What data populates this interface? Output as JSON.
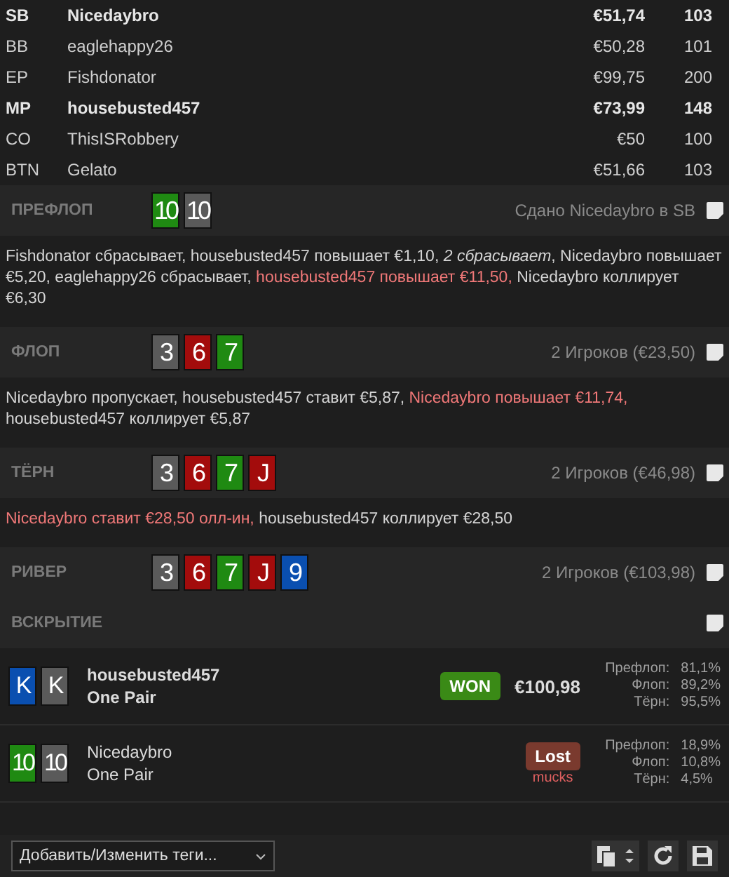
{
  "players": [
    {
      "position": "SB",
      "name": "Nicedaybro",
      "stack": "€51,74",
      "bb": "103",
      "highlighted": true
    },
    {
      "position": "BB",
      "name": "eaglehappy26",
      "stack": "€50,28",
      "bb": "101",
      "highlighted": false
    },
    {
      "position": "EP",
      "name": "Fishdonator",
      "stack": "€99,75",
      "bb": "200",
      "highlighted": false
    },
    {
      "position": "MP",
      "name": "housebusted457",
      "stack": "€73,99",
      "bb": "148",
      "highlighted": true
    },
    {
      "position": "CO",
      "name": "ThisISRobbery",
      "stack": "€50",
      "bb": "100",
      "highlighted": false
    },
    {
      "position": "BTN",
      "name": "Gelato",
      "stack": "€51,66",
      "bb": "103",
      "highlighted": false
    }
  ],
  "streets": [
    {
      "title": "ПРЕФЛОП",
      "cards": [
        {
          "rank": "10",
          "color": "#1f8a12"
        },
        {
          "rank": "10",
          "color": "#5a5a5a"
        }
      ],
      "info": "Сдано Nicedaybro в SB",
      "actions": [
        {
          "kind": "plain",
          "text": "Fishdonator сбрасывает, housebusted457 повышает €1,10, "
        },
        {
          "kind": "italic",
          "text": "2 сбрасывает"
        },
        {
          "kind": "plain",
          "text": ", Nicedaybro повышает €5,20, eaglehappy26 сбрасывает, "
        },
        {
          "kind": "aggressive",
          "text": "housebusted457 повышает €11,50,"
        },
        {
          "kind": "plain",
          "text": " Nicedaybro коллирует €6,30"
        }
      ]
    },
    {
      "title": "ФЛОП",
      "cards": [
        {
          "rank": "3",
          "color": "#5a5a5a"
        },
        {
          "rank": "6",
          "color": "#a30c0c"
        },
        {
          "rank": "7",
          "color": "#1f8a12"
        }
      ],
      "info": "2 Игроков (€23,50)",
      "actions": [
        {
          "kind": "plain",
          "text": "Nicedaybro пропускает, housebusted457 ставит €5,87, "
        },
        {
          "kind": "aggressive",
          "text": "Nicedaybro повышает €11,74,"
        },
        {
          "kind": "plain",
          "text": " housebusted457 коллирует €5,87"
        }
      ]
    },
    {
      "title": "ТЁРН",
      "cards": [
        {
          "rank": "3",
          "color": "#5a5a5a"
        },
        {
          "rank": "6",
          "color": "#a30c0c"
        },
        {
          "rank": "7",
          "color": "#1f8a12"
        },
        {
          "rank": "J",
          "color": "#a30c0c"
        }
      ],
      "info": "2 Игроков (€46,98)",
      "actions": [
        {
          "kind": "aggressive",
          "text": "Nicedaybro ставит €28,50 олл-ин,"
        },
        {
          "kind": "plain",
          "text": " housebusted457 коллирует €28,50"
        }
      ]
    },
    {
      "title": "РИВЕР",
      "cards": [
        {
          "rank": "3",
          "color": "#5a5a5a"
        },
        {
          "rank": "6",
          "color": "#a30c0c"
        },
        {
          "rank": "7",
          "color": "#1f8a12"
        },
        {
          "rank": "J",
          "color": "#a30c0c"
        },
        {
          "rank": "9",
          "color": "#0a4fb0"
        }
      ],
      "info": "2 Игроков (€103,98)"
    }
  ],
  "showdown": {
    "title": "ВСКРЫТИЕ",
    "hands": [
      {
        "cards": [
          {
            "rank": "K",
            "color": "#0a4fb0"
          },
          {
            "rank": "K",
            "color": "#5a5a5a"
          }
        ],
        "name": "housebusted457",
        "hand": "One Pair",
        "winner": true,
        "result": "WON",
        "amount": "€100,98",
        "equity": [
          {
            "street": "Префлоп:",
            "value": "81,1%"
          },
          {
            "street": "Флоп:",
            "value": "89,2%"
          },
          {
            "street": "Тёрн:",
            "value": "95,5%"
          }
        ]
      },
      {
        "cards": [
          {
            "rank": "10",
            "color": "#1f8a12"
          },
          {
            "rank": "10",
            "color": "#5a5a5a"
          }
        ],
        "name": "Nicedaybro",
        "hand": "One Pair",
        "winner": false,
        "result": "Lost",
        "note": "mucks",
        "equity": [
          {
            "street": "Префлоп:",
            "value": "18,9%"
          },
          {
            "street": "Флоп:",
            "value": "10,8%"
          },
          {
            "street": "Тёрн:",
            "value": "4,5%"
          }
        ]
      }
    ]
  },
  "footer": {
    "tags_select": "Добавить/Изменить теги..."
  }
}
